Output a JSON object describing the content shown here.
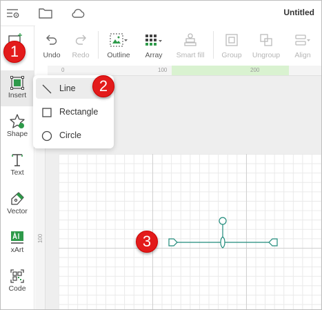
{
  "header": {
    "title": "Untitled",
    "icons": [
      "menu-settings-icon",
      "folder-icon",
      "cloud-icon"
    ]
  },
  "toolbar": {
    "undo": "Undo",
    "redo": "Redo",
    "outline": "Outline",
    "array": "Array",
    "smart_fill": "Smart fill",
    "group": "Group",
    "ungroup": "Ungroup",
    "align": "Align"
  },
  "sidebar": {
    "items": [
      {
        "label": "Insert",
        "icon": "insert-icon"
      },
      {
        "label": "Shape",
        "icon": "star-icon"
      },
      {
        "label": "Text",
        "icon": "text-icon"
      },
      {
        "label": "Vector",
        "icon": "pen-icon"
      },
      {
        "label": "xArt",
        "icon": "ai-icon"
      },
      {
        "label": "Code",
        "icon": "qr-code-icon"
      }
    ]
  },
  "ruler": {
    "h_labels": [
      "0",
      "100",
      "200"
    ],
    "v_labels": [
      "100"
    ]
  },
  "insert_menu": {
    "items": [
      {
        "label": "Line",
        "icon": "line-icon"
      },
      {
        "label": "Rectangle",
        "icon": "square-icon"
      },
      {
        "label": "Circle",
        "icon": "circle-icon"
      }
    ]
  },
  "callouts": [
    "1",
    "2",
    "3"
  ],
  "colors": {
    "accent_green": "#2e9a4a",
    "callout_red": "#e31b1b",
    "shape_teal": "#1f8a7a"
  }
}
